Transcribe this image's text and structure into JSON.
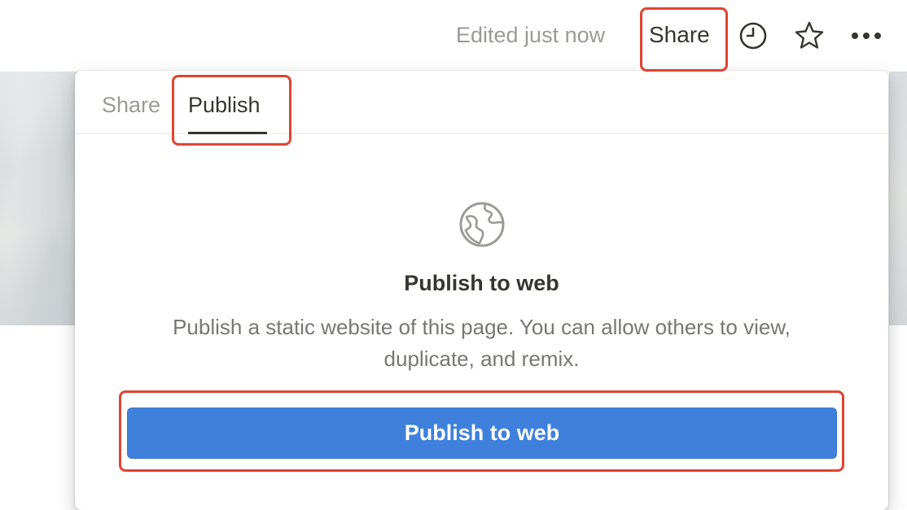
{
  "topbar": {
    "edited_status": "Edited just now",
    "share_label": "Share",
    "icons": [
      "clock-icon",
      "star-icon",
      "more-icon"
    ]
  },
  "popup": {
    "tabs": [
      {
        "label": "Share",
        "active": false
      },
      {
        "label": "Publish",
        "active": true
      }
    ],
    "icon": "globe-icon",
    "heading": "Publish to web",
    "description": "Publish a static website of this page. You can allow others to view, duplicate, and remix.",
    "button_label": "Publish to web"
  },
  "colors": {
    "accent": "#3e80dc",
    "highlight": "#e0432f",
    "text": "#37352f",
    "muted": "#9b9a97"
  }
}
